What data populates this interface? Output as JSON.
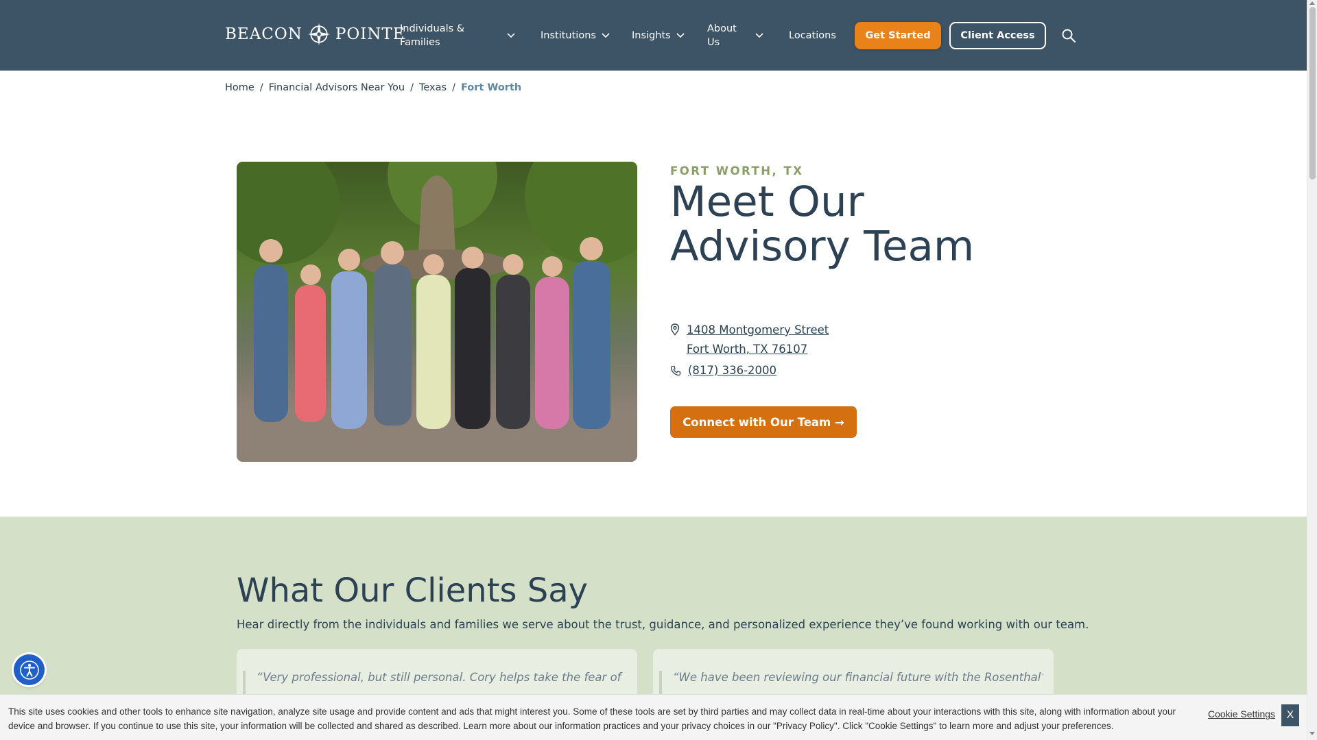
{
  "header": {
    "logo_left": "BEACON",
    "logo_right": "POINTE",
    "nav": [
      {
        "label": "Individuals & Families"
      },
      {
        "label": "Institutions"
      },
      {
        "label": "Insights"
      },
      {
        "label": "About Us"
      },
      {
        "label": "Locations"
      }
    ],
    "get_started": "Get Started",
    "client_access": "Client Access",
    "colors": {
      "bar": "#3d5466",
      "accent": "#e88219"
    }
  },
  "breadcrumb": {
    "home": "Home",
    "advisors": "Financial Advisors Near You",
    "state": "Texas",
    "current": "Fort Worth",
    "separator": "/"
  },
  "hero": {
    "eyebrow": "FORT WORTH, TX",
    "title": "Meet Our Advisory Team",
    "address_line1": "1408 Montgomery Street",
    "address_line2": "Fort Worth, TX 76107",
    "phone": "(817) 336-2000",
    "cta": "Connect with Our Team →"
  },
  "testimonials": {
    "title": "What Our Clients Say",
    "subtitle": "Hear directly from the individuals and families we serve about the trust, guidance, and personalized experience they’ve found working with our team.",
    "cards": [
      {
        "quote": "“Very professional, but still personal. Cory helps take the fear of"
      },
      {
        "quote": "“We have been reviewing our financial future with the Rosenthal’s /"
      }
    ],
    "background": "#d4e1c8"
  },
  "cookie": {
    "text": "This site uses cookies and other tools to enhance site navigation, analyze site usage and provide content and ads that might interest you. Some of these tools are set by third parties and may collect data in real-time about your interactions with this site, along with information about your device and browser. If you continue to use this site, your information will be collected and shared as described. Learn more about our information practices and your privacy choices in our \"Privacy Policy\". Click \"Cookie Settings\" to learn more and adjust your preferences.",
    "settings": "Cookie Settings",
    "close": "X"
  },
  "icons": {
    "search": "search-icon",
    "chevron": "chevron-down-icon",
    "location": "location-pin-icon",
    "phone": "phone-icon",
    "accessibility": "accessibility-icon"
  }
}
